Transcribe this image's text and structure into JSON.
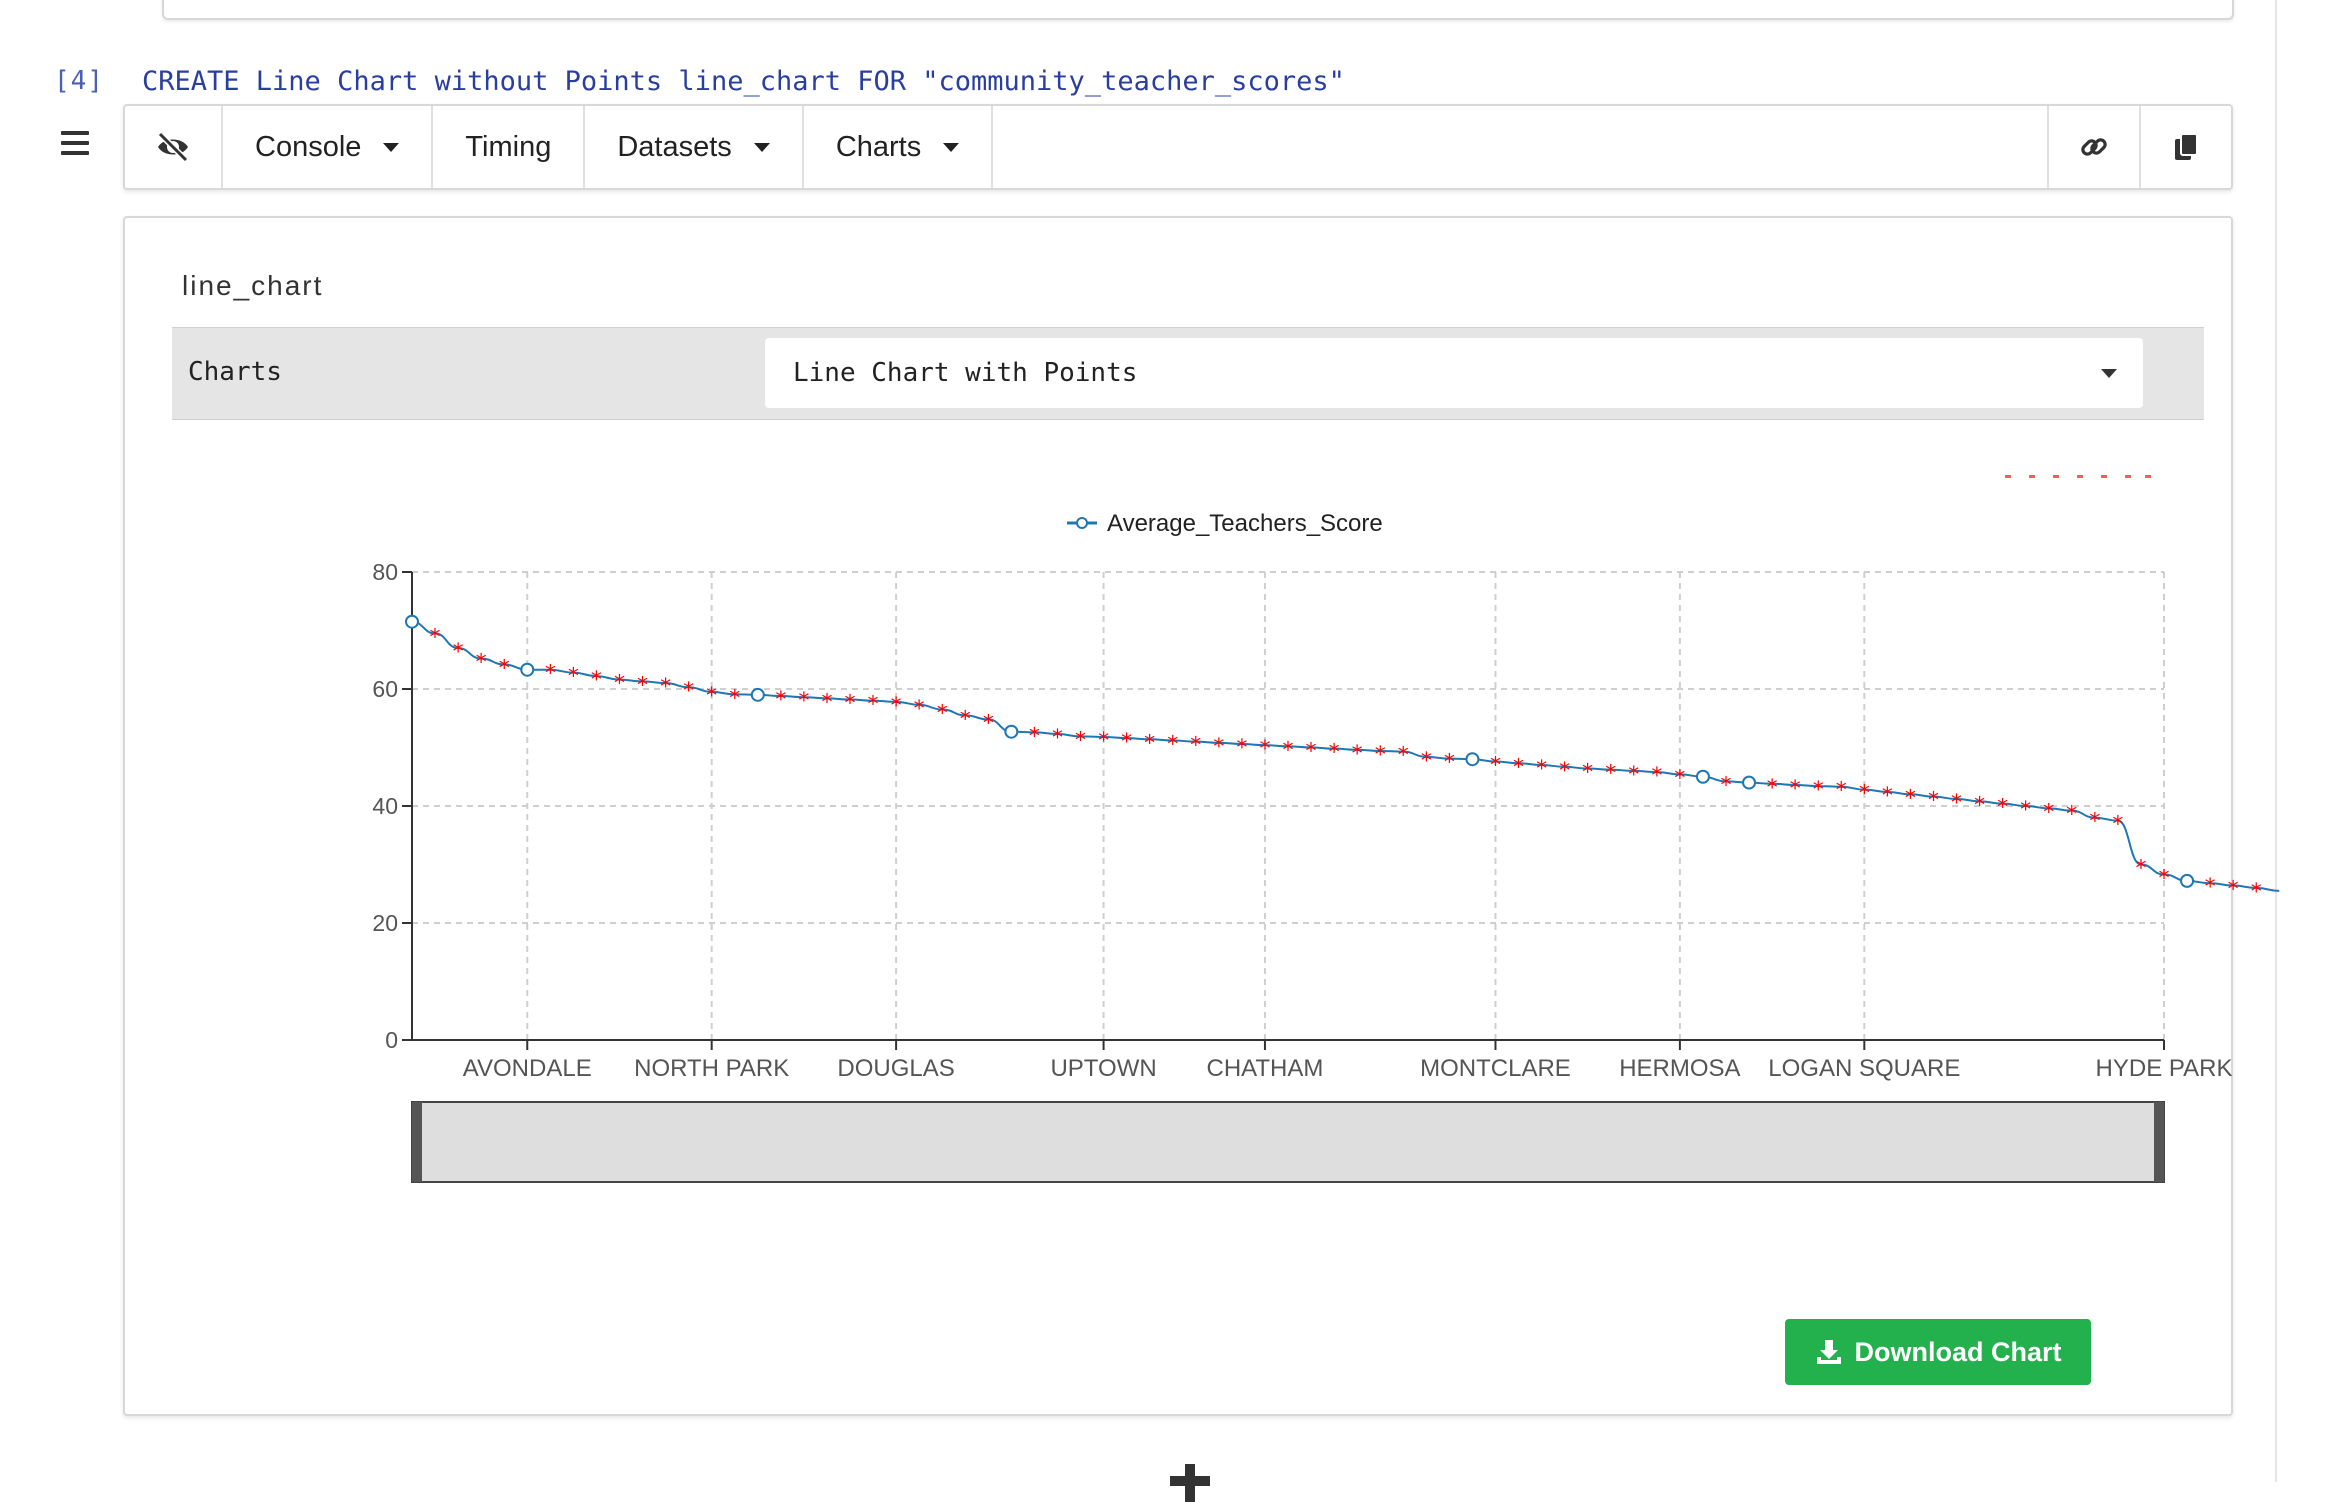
{
  "cell": {
    "prompt": "[4]",
    "code": "CREATE Line Chart without Points line_chart FOR \"community_teacher_scores\""
  },
  "toolbar": {
    "console_label": "Console",
    "timing_label": "Timing",
    "datasets_label": "Datasets",
    "charts_label": "Charts",
    "icons": [
      "eye-slash-icon",
      "link-icon",
      "copy-icon"
    ]
  },
  "panel": {
    "title": "line_chart",
    "charts_label": "Charts",
    "chart_select_value": "Line Chart with Points"
  },
  "download": {
    "label": "Download Chart"
  },
  "colors": {
    "line": "#1f77b4",
    "marker_star": "#ff0000",
    "download_bg": "#22b14c"
  },
  "chart_data": {
    "type": "line",
    "title": "",
    "xlabel": "",
    "ylabel": "",
    "ylim": [
      0,
      80
    ],
    "yticks": [
      0,
      20,
      40,
      60,
      80
    ],
    "grid": true,
    "legend": "top-center",
    "x_tick_labels": [
      "AVONDALE",
      "NORTH PARK",
      "DOUGLAS",
      "UPTOWN",
      "CHATHAM",
      "MONTCLARE",
      "HERMOSA",
      "LOGAN SQUARE",
      "HYDE PARK"
    ],
    "series": [
      {
        "name": "Average_Teachers_Score",
        "values": [
          71.5,
          69.5,
          67.0,
          65.2,
          64.2,
          63.3,
          63.3,
          62.8,
          62.2,
          61.6,
          61.3,
          61.0,
          60.3,
          59.5,
          59.1,
          59.0,
          58.8,
          58.6,
          58.4,
          58.2,
          58.0,
          57.8,
          57.3,
          56.5,
          55.5,
          54.8,
          52.7,
          52.6,
          52.3,
          51.9,
          51.8,
          51.6,
          51.4,
          51.2,
          51.0,
          50.8,
          50.6,
          50.4,
          50.2,
          50.0,
          49.8,
          49.6,
          49.4,
          49.3,
          48.4,
          48.1,
          48.0,
          47.6,
          47.3,
          47.0,
          46.7,
          46.4,
          46.2,
          46.0,
          45.8,
          45.4,
          45.0,
          44.2,
          44.0,
          43.8,
          43.6,
          43.4,
          43.3,
          42.8,
          42.4,
          42.0,
          41.6,
          41.2,
          40.8,
          40.4,
          40.0,
          39.6,
          39.2,
          38.0,
          37.5,
          30.0,
          28.3,
          27.2,
          26.8,
          26.4,
          26.0,
          25.5
        ],
        "hollow_marker_indices": [
          0,
          5,
          15,
          26,
          46,
          56,
          58,
          77
        ]
      }
    ]
  }
}
